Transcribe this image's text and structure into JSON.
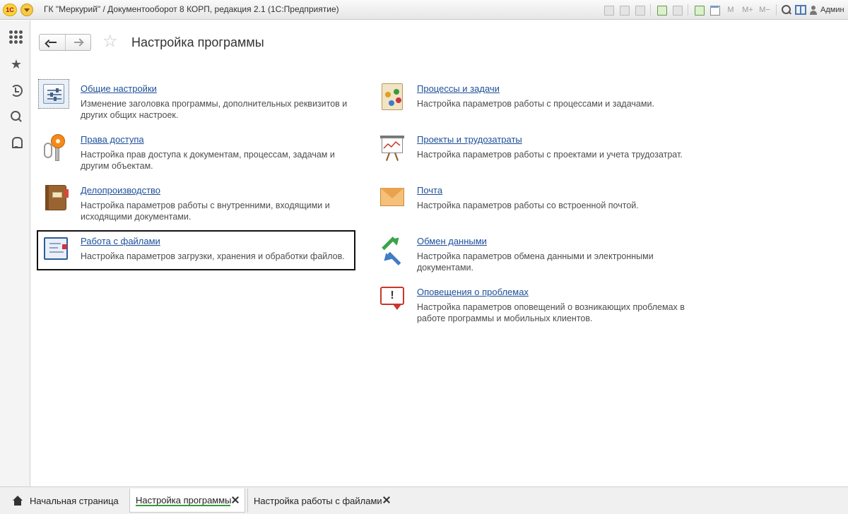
{
  "window": {
    "title": "ГК \"Меркурий\" / Документооборот 8 КОРП, редакция 2.1  (1С:Предприятие)",
    "logo_text": "1С",
    "user": "Админ"
  },
  "toolbar": {
    "m_label": "M",
    "m_plus_label": "M+",
    "m_minus_label": "M−"
  },
  "header": {
    "title": "Настройка программы"
  },
  "sections": {
    "left": [
      {
        "title": "Общие настройки",
        "desc": "Изменение заголовка программы, дополнительных реквизитов и других общих настроек.",
        "icon": "settings-sliders-icon"
      },
      {
        "title": "Права доступа",
        "desc": "Настройка прав доступа к документам, процессам, задачам и другим объектам.",
        "icon": "key-icon"
      },
      {
        "title": "Делопроизводство",
        "desc": "Настройка параметров работы с внутренними, входящими и исходящими документами.",
        "icon": "book-icon"
      },
      {
        "title": "Работа с файлами",
        "desc": "Настройка параметров загрузки, хранения и обработки файлов.",
        "icon": "file-window-icon"
      }
    ],
    "right": [
      {
        "title": "Процессы и задачи",
        "desc": "Настройка параметров работы с процессами и задачами.",
        "icon": "process-icon"
      },
      {
        "title": "Проекты и трудозатраты",
        "desc": "Настройка параметров работы с проектами и учета трудозатрат.",
        "icon": "presentation-board-icon"
      },
      {
        "title": "Почта",
        "desc": "Настройка параметров работы со встроенной почтой.",
        "icon": "envelope-icon"
      },
      {
        "title": "Обмен данными",
        "desc": "Настройка параметров обмена данными и электронными документами.",
        "icon": "exchange-arrows-icon"
      },
      {
        "title": "Оповещения о проблемах",
        "desc": "Настройка параметров оповещений о возникающих проблемах в работе программы и мобильных клиентов.",
        "icon": "alert-bubble-icon"
      }
    ]
  },
  "tabs": [
    {
      "label": "Начальная страница",
      "active": false
    },
    {
      "label": "Настройка программы",
      "active": true
    },
    {
      "label": "Настройка работы с файлами",
      "active": false
    }
  ],
  "colors": {
    "link": "#1d4f9a",
    "active_tab_underline": "#3a9a3a"
  }
}
